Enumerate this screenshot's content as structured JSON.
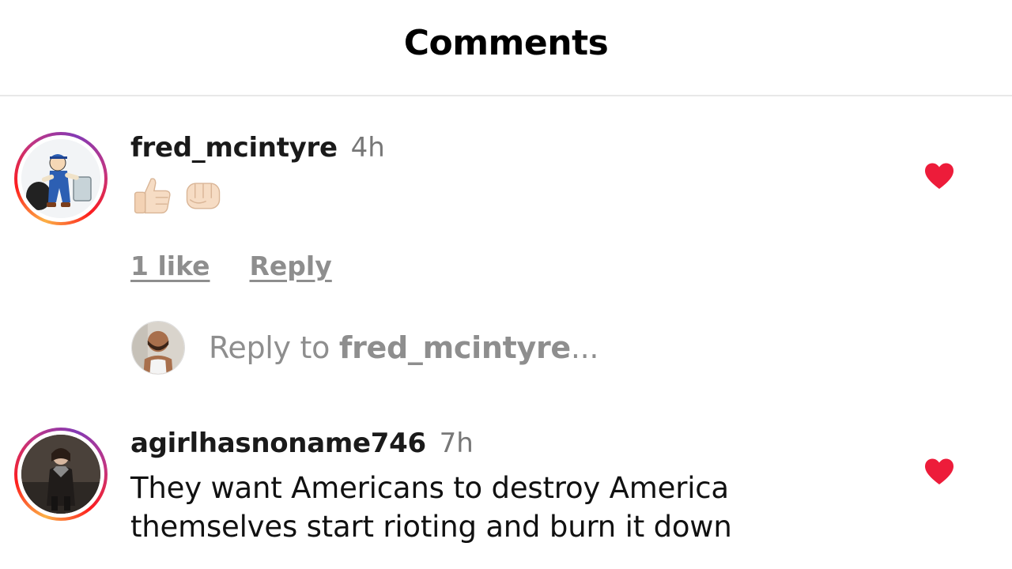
{
  "header": {
    "title": "Comments"
  },
  "comments": [
    {
      "username": "fred_mcintyre",
      "time": "4h",
      "emojis": [
        "thumbs-up-emoji",
        "fist-emoji"
      ],
      "likes_label": "1 like",
      "reply_label": "Reply",
      "liked": true
    },
    {
      "username": "agirlhasnoname746",
      "time": "7h",
      "text": "They want Americans to destroy America themselves start rioting and burn it down",
      "liked": true
    }
  ],
  "reply_box": {
    "prefix": "Reply to ",
    "target_user": "fred_mcintyre",
    "suffix": "..."
  },
  "colors": {
    "heart": "#ed1c3a",
    "muted_text": "#8e8e8e",
    "timestamp": "#777777"
  }
}
